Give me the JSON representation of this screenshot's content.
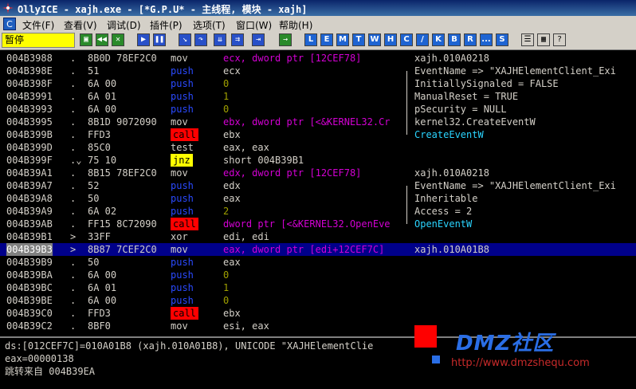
{
  "window": {
    "title": "OllyICE - xajh.exe - [*G.P.U* - 主线程, 模块 - xajh]"
  },
  "menu": [
    "文件(F)",
    "查看(V)",
    "调试(D)",
    "插件(P)",
    "选项(T)",
    "窗口(W)",
    "帮助(H)"
  ],
  "toolbar": {
    "status": "暂停",
    "letters": [
      "L",
      "E",
      "M",
      "T",
      "W",
      "H",
      "C",
      "/",
      "K",
      "B",
      "R",
      "...",
      "S"
    ]
  },
  "rows": [
    {
      "addr": "004B3988",
      "mark": ".",
      "hex": "8B0D 78EF2C0",
      "mn": "mov",
      "mc": "mov",
      "ops": "ecx, dword ptr [12CEF78]",
      "oc": "mem",
      "cmt": "xajh.010A0218",
      "cc": ""
    },
    {
      "addr": "004B398E",
      "mark": ".",
      "hex": "51",
      "mn": "push",
      "mc": "push",
      "ops": "ecx",
      "oc": "reg",
      "cmt": "EventName => \"XAJHElementClient_Exi",
      "cc": ""
    },
    {
      "addr": "004B398F",
      "mark": ".",
      "hex": "6A 00",
      "mn": "push",
      "mc": "push",
      "ops": "0",
      "oc": "num",
      "cmt": "InitiallySignaled = FALSE",
      "cc": ""
    },
    {
      "addr": "004B3991",
      "mark": ".",
      "hex": "6A 01",
      "mn": "push",
      "mc": "push",
      "ops": "1",
      "oc": "num",
      "cmt": "ManualReset = TRUE",
      "cc": ""
    },
    {
      "addr": "004B3993",
      "mark": ".",
      "hex": "6A 00",
      "mn": "push",
      "mc": "push",
      "ops": "0",
      "oc": "num",
      "cmt": "pSecurity = NULL",
      "cc": ""
    },
    {
      "addr": "004B3995",
      "mark": ".",
      "hex": "8B1D 9072090",
      "mn": "mov",
      "mc": "mov",
      "ops": "ebx, dword ptr [<&KERNEL32.Cr",
      "oc": "mem",
      "cmt": "kernel32.CreateEventW",
      "cc": ""
    },
    {
      "addr": "004B399B",
      "mark": ".",
      "hex": "FFD3",
      "mn": "call",
      "mc": "call",
      "ops": "ebx",
      "oc": "reg",
      "cmt": "CreateEventW",
      "cc": "cyan"
    },
    {
      "addr": "004B399D",
      "mark": ".",
      "hex": "85C0",
      "mn": "test",
      "mc": "test",
      "ops": "eax, eax",
      "oc": "reg",
      "cmt": "",
      "cc": ""
    },
    {
      "addr": "004B399F",
      "mark": ".⌄",
      "hex": "75 10",
      "mn": "jnz",
      "mc": "jnz",
      "ops": "short 004B39B1",
      "oc": "short",
      "cmt": "",
      "cc": ""
    },
    {
      "addr": "004B39A1",
      "mark": ".",
      "hex": "8B15 78EF2C0",
      "mn": "mov",
      "mc": "mov",
      "ops": "edx, dword ptr [12CEF78]",
      "oc": "mem",
      "cmt": "xajh.010A0218",
      "cc": ""
    },
    {
      "addr": "004B39A7",
      "mark": ".",
      "hex": "52",
      "mn": "push",
      "mc": "push",
      "ops": "edx",
      "oc": "reg",
      "cmt": "EventName => \"XAJHElementClient_Exi",
      "cc": ""
    },
    {
      "addr": "004B39A8",
      "mark": ".",
      "hex": "50",
      "mn": "push",
      "mc": "push",
      "ops": "eax",
      "oc": "reg",
      "cmt": "Inheritable",
      "cc": ""
    },
    {
      "addr": "004B39A9",
      "mark": ".",
      "hex": "6A 02",
      "mn": "push",
      "mc": "push",
      "ops": "2",
      "oc": "num",
      "cmt": "Access = 2",
      "cc": ""
    },
    {
      "addr": "004B39AB",
      "mark": ".",
      "hex": "FF15 8C72090",
      "mn": "call",
      "mc": "call",
      "ops": "dword ptr [<&KERNEL32.OpenEve",
      "oc": "mem",
      "cmt": "OpenEventW",
      "cc": "cyan"
    },
    {
      "addr": "004B39B1",
      "mark": ">",
      "hex": "33FF",
      "mn": "xor",
      "mc": "xor",
      "ops": "edi, edi",
      "oc": "reg",
      "cmt": "",
      "cc": ""
    },
    {
      "addr": "004B39B3",
      "mark": ">",
      "hex": "8B87 7CEF2C0",
      "mn": "mov",
      "mc": "mov",
      "ops": "eax, dword ptr [edi+12CEF7C]",
      "oc": "mem",
      "cmt": "xajh.010A01B8",
      "cc": "",
      "sel": true
    },
    {
      "addr": "004B39B9",
      "mark": ".",
      "hex": "50",
      "mn": "push",
      "mc": "push",
      "ops": "eax",
      "oc": "reg",
      "cmt": "",
      "cc": ""
    },
    {
      "addr": "004B39BA",
      "mark": ".",
      "hex": "6A 00",
      "mn": "push",
      "mc": "push",
      "ops": "0",
      "oc": "num",
      "cmt": "",
      "cc": ""
    },
    {
      "addr": "004B39BC",
      "mark": ".",
      "hex": "6A 01",
      "mn": "push",
      "mc": "push",
      "ops": "1",
      "oc": "num",
      "cmt": "",
      "cc": ""
    },
    {
      "addr": "004B39BE",
      "mark": ".",
      "hex": "6A 00",
      "mn": "push",
      "mc": "push",
      "ops": "0",
      "oc": "num",
      "cmt": "",
      "cc": ""
    },
    {
      "addr": "004B39C0",
      "mark": ".",
      "hex": "FFD3",
      "mn": "call",
      "mc": "call",
      "ops": "ebx",
      "oc": "reg",
      "cmt": "",
      "cc": ""
    },
    {
      "addr": "004B39C2",
      "mark": ".",
      "hex": "8BF0",
      "mn": "mov",
      "mc": "mov",
      "ops": "esi, eax",
      "oc": "reg",
      "cmt": "",
      "cc": ""
    }
  ],
  "info": {
    "line1": "ds:[012CEF7C]=010A01B8 (xajh.010A01B8), UNICODE \"XAJHElementClie",
    "line2": "eax=00000138",
    "line3": "跳转来自 004B39EA"
  },
  "logo": {
    "text": "DMZ社区",
    "url": "http://www.dmzshequ.com"
  }
}
